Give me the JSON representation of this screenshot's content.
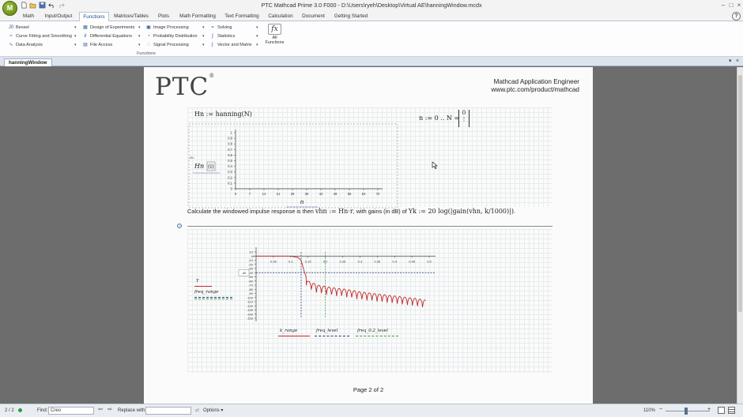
{
  "window": {
    "title": "PTC Mathcad Prime 3.0 F000 - D:\\Users\\ryeh\\Desktop\\Virtual AE\\hanningWindow.mcdx",
    "app_logo_letter": "M",
    "controls": [
      "–",
      "□",
      "×"
    ]
  },
  "ribbon": {
    "tabs": [
      "Math",
      "Input/Output",
      "Functions",
      "Matrices/Tables",
      "Plots",
      "Math Formatting",
      "Text Formatting",
      "Calculation",
      "Document",
      "Getting Started"
    ],
    "active_tab": "Functions",
    "help": "?",
    "col1": [
      {
        "icon": "J0",
        "label": "Bessel"
      },
      {
        "icon": "≈",
        "label": "Curve Fitting and Smoothing"
      },
      {
        "icon": "∿",
        "label": "Data Analysis"
      }
    ],
    "col2": [
      {
        "icon": "▦",
        "label": "Design of Experiments"
      },
      {
        "icon": "∂",
        "label": "Differential Equations"
      },
      {
        "icon": "▤",
        "label": "File Access"
      }
    ],
    "col3": [
      {
        "icon": "▣",
        "label": "Image Processing"
      },
      {
        "icon": "◔",
        "label": "Probability Distribution"
      },
      {
        "icon": "◌",
        "label": "Signal Processing"
      }
    ],
    "col4": [
      {
        "icon": "=",
        "label": "Solving"
      },
      {
        "icon": "∫",
        "label": "Statistics"
      },
      {
        "icon": "|:",
        "label": "Vector and Matrix"
      }
    ],
    "all_functions": {
      "icon": "fx",
      "line1": "All",
      "line2": "Functions"
    },
    "group_label": "Functions"
  },
  "document": {
    "tab_name": "hanningWindow",
    "tab_controls": [
      "▾",
      "×"
    ],
    "logo": "PTC",
    "logo_mark": "®",
    "header_line1": "Mathcad Application Engineer",
    "header_line2": "www.ptc.com/product/mathcad",
    "def_hn": "Hn := hanning(N)",
    "def_n": "n := 0 .. N =",
    "n_matrix": [
      "0",
      "⋮"
    ],
    "plot1": {
      "y_label": "Hn(i)",
      "y_label_left": "Hn",
      "y_label_arg": "(i)",
      "x_label": "n",
      "y_small_label": "Hn",
      "x_ticks": [
        "0",
        "7",
        "14",
        "21",
        "28",
        "35",
        "42",
        "49",
        "56",
        "63",
        "70"
      ],
      "y_ticks": [
        "1",
        "0.9",
        "0.8",
        "0.7",
        "0.6",
        "0.5",
        "0.4",
        "0.3",
        "0.2",
        "0.1",
        "0"
      ]
    },
    "calc_text": {
      "prefix": "Calculate the windowed impulse response is then",
      "expr1": "vhn := Hn·r",
      "middle": ", with gains (in dB) of",
      "expr2": "Yk := 20 log(|gain(vhn, k/1000)|)",
      "suffix": "."
    },
    "plot2": {
      "y_label": "Y",
      "y_label2": "freq_range",
      "x_labels": [
        "k_range",
        "freq_level",
        "freq_0.2_level"
      ],
      "x_ticks": [
        "0.05",
        "0.1",
        "0.15",
        "0.2",
        "0.25",
        "0.3",
        "0.35",
        "0.4",
        "0.45",
        "0.5"
      ],
      "y_ticks": [
        "10",
        "0",
        "-10",
        "-20",
        "-30",
        "-40",
        "-50",
        "-60",
        "-70",
        "-80",
        "-90",
        "-100",
        "-110",
        "-120",
        "-130",
        "-140",
        "-150"
      ],
      "marker": "-40"
    },
    "page_label": "Page 2 of 2"
  },
  "chart_data": [
    {
      "type": "line",
      "title": "",
      "xlabel": "n",
      "ylabel": "Hn(i)",
      "xlim": [
        0,
        70
      ],
      "ylim": [
        0,
        1
      ],
      "series": []
    },
    {
      "type": "line",
      "title": "",
      "xlabel": "k_range  freq_level  freq_0.2_level",
      "ylabel": "Y  freq_range",
      "xlim": [
        0,
        0.5
      ],
      "ylim": [
        -150,
        10
      ],
      "x": [
        0,
        0.1,
        0.12,
        0.13,
        0.14,
        0.15,
        0.18,
        0.22,
        0.26,
        0.3,
        0.34,
        0.38,
        0.42,
        0.46,
        0.49
      ],
      "series": [
        {
          "name": "Y",
          "color": "#c0282c",
          "values": [
            0,
            0,
            -3,
            -10,
            -40,
            -60,
            -70,
            -76,
            -80,
            -86,
            -90,
            -94,
            -98,
            -102,
            -106
          ]
        }
      ],
      "reference_lines": {
        "horizontal_y": -40,
        "vertical_x": [
          0.13,
          0.2
        ]
      }
    }
  ],
  "statusbar": {
    "page_count": "2 / 2",
    "find_label": "Find:",
    "find_value": "Creo",
    "replace_label": "Replace with:",
    "replace_value": "",
    "options": "Options",
    "zoom": "110%"
  },
  "colors": {
    "accent": "#1f4e8c",
    "curve": "#c0282c",
    "ref_line": "#1d3f7a",
    "green_line": "#3a9a3a",
    "workspace": "#6d6d6d"
  }
}
